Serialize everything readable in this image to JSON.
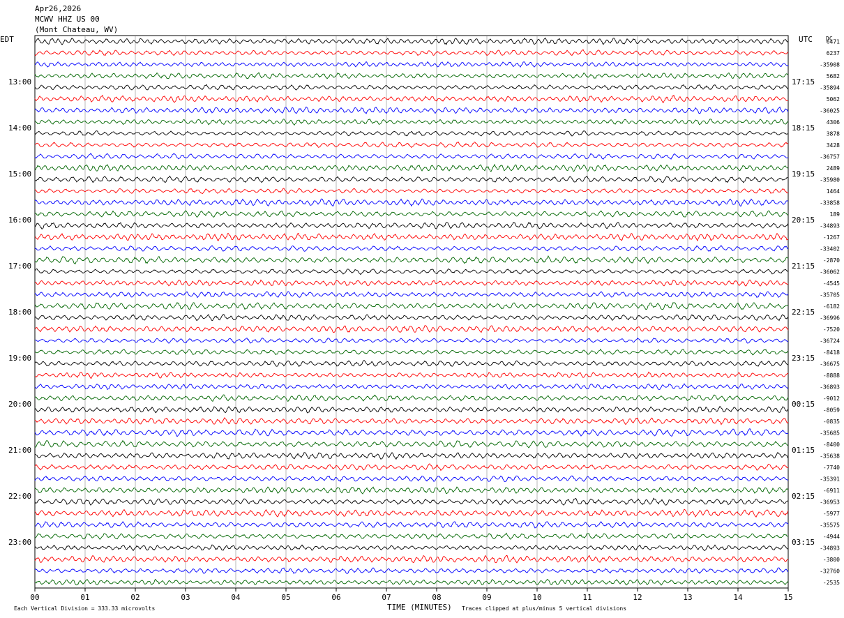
{
  "header": {
    "date": "Apr26,2026",
    "station": "MCWV HHZ US 00",
    "location": "(Mont Chateau, WV)"
  },
  "axes": {
    "left_tz": "EDT",
    "right_tz": "UTC",
    "right_col": "DC",
    "xlabel": "TIME (MINUTES)"
  },
  "footer": {
    "scale_note": "Each Vertical Division =  333.33 microvolts",
    "clip_note": "Traces clipped at plus/minus 5 vertical divisions"
  },
  "chart_data": {
    "type": "line",
    "kind": "helicorder",
    "x_range_minutes": [
      0,
      15
    ],
    "x_ticks": [
      "00",
      "01",
      "02",
      "03",
      "04",
      "05",
      "06",
      "07",
      "08",
      "09",
      "10",
      "11",
      "12",
      "13",
      "14",
      "15"
    ],
    "row_count": 48,
    "row_minutes": 15,
    "trace_colors": [
      "#000000",
      "#ff0000",
      "#0000ff",
      "#006600"
    ],
    "left_hour_labels": [
      "13:00",
      "14:00",
      "15:00",
      "16:00",
      "17:00",
      "18:00",
      "19:00",
      "20:00",
      "21:00",
      "22:00",
      "23:00"
    ],
    "right_hour_labels": [
      "17:15",
      "18:15",
      "19:15",
      "20:15",
      "21:15",
      "22:15",
      "23:15",
      "00:15",
      "01:15",
      "02:15",
      "03:15"
    ],
    "hour_label_first_row": 4,
    "dc_offsets": [
      "6471",
      "6237",
      "-35908",
      "5682",
      "-35894",
      "5062",
      "-36025",
      "4306",
      "3878",
      "3428",
      "-36757",
      "2489",
      "-35980",
      "1464",
      "-33858",
      "189",
      "-34893",
      "-1267",
      "-33402",
      "-2870",
      "-36062",
      "-4545",
      "-35705",
      "-6182",
      "-36996",
      "-7520",
      "-36724",
      "-8418",
      "-36675",
      "-8888",
      "-36893",
      "-9012",
      "-8059",
      "-0835",
      "-35685",
      "-8400",
      "-35638",
      "-7740",
      "-35391",
      "-6911",
      "-36953",
      "-5977",
      "-35575",
      "-4944",
      "-34893",
      "-3800",
      "-32760",
      "-2535"
    ],
    "grid": true,
    "clip_divisions": 5
  }
}
